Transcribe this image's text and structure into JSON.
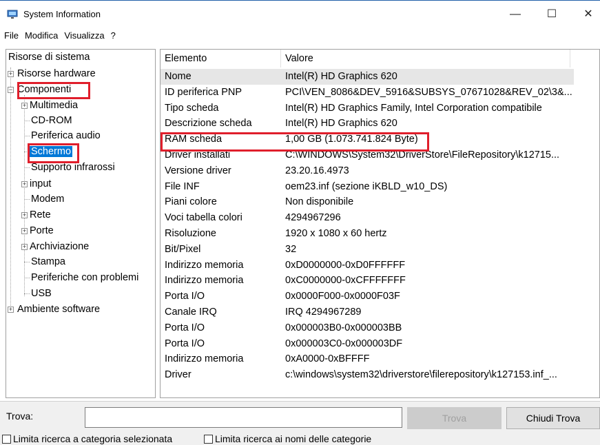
{
  "window": {
    "title": "System Information"
  },
  "window_controls": {
    "minimize": "—",
    "maximize": "☐",
    "close": "✕"
  },
  "menu": [
    "File",
    "Modifica",
    "Visualizza",
    "?"
  ],
  "tree": {
    "root": "Risorse di sistema",
    "items": [
      {
        "label": "Risorse hardware"
      },
      {
        "label": "Componenti"
      },
      {
        "label": "Multimedia"
      },
      {
        "label": "CD-ROM"
      },
      {
        "label": "Periferica audio"
      },
      {
        "label": "Schermo"
      },
      {
        "label": "Supporto infrarossi"
      },
      {
        "label": "input"
      },
      {
        "label": "Modem"
      },
      {
        "label": "Rete"
      },
      {
        "label": "Porte"
      },
      {
        "label": "Archiviazione"
      },
      {
        "label": "Stampa"
      },
      {
        "label": "Periferiche con problemi"
      },
      {
        "label": "USB"
      },
      {
        "label": "Ambiente software"
      }
    ]
  },
  "detail": {
    "columns": [
      "Elemento",
      "Valore"
    ],
    "rows": [
      {
        "name": "Nome",
        "value": "Intel(R) HD Graphics 620"
      },
      {
        "name": "ID periferica PNP",
        "value": "PCI\\VEN_8086&DEV_5916&SUBSYS_07671028&REV_02\\3&..."
      },
      {
        "name": "Tipo scheda",
        "value": "Intel(R) HD Graphics Family, Intel Corporation compatibile"
      },
      {
        "name": "Descrizione scheda",
        "value": "Intel(R) HD Graphics 620"
      },
      {
        "name": "RAM scheda",
        "value": "1,00 GB (1.073.741.824 Byte)"
      },
      {
        "name": "Driver installati",
        "value": "C:\\WINDOWS\\System32\\DriverStore\\FileRepository\\k12715..."
      },
      {
        "name": "Versione driver",
        "value": "23.20.16.4973"
      },
      {
        "name": "File INF",
        "value": "oem23.inf (sezione iKBLD_w10_DS)"
      },
      {
        "name": "Piani colore",
        "value": "Non disponibile"
      },
      {
        "name": "Voci tabella colori",
        "value": "4294967296"
      },
      {
        "name": "Risoluzione",
        "value": "1920 x 1080 x 60 hertz"
      },
      {
        "name": "Bit/Pixel",
        "value": "32"
      },
      {
        "name": "Indirizzo memoria",
        "value": "0xD0000000-0xD0FFFFFF"
      },
      {
        "name": "Indirizzo memoria",
        "value": "0xC0000000-0xCFFFFFFF"
      },
      {
        "name": "Porta I/O",
        "value": "0x0000F000-0x0000F03F"
      },
      {
        "name": "Canale IRQ",
        "value": "IRQ 4294967289"
      },
      {
        "name": "Porta I/O",
        "value": "0x000003B0-0x000003BB"
      },
      {
        "name": "Porta I/O",
        "value": "0x000003C0-0x000003DF"
      },
      {
        "name": "Indirizzo memoria",
        "value": "0xA0000-0xBFFFF"
      },
      {
        "name": "Driver",
        "value": "c:\\windows\\system32\\driverstore\\filerepository\\k127153.inf_..."
      }
    ]
  },
  "find": {
    "label": "Trova:",
    "value": "",
    "find_button": "Trova",
    "close_button": "Chiudi Trova",
    "option_category": "Limita ricerca a categoria selezionata",
    "option_names": "Limita ricerca ai nomi delle categorie"
  },
  "colors": {
    "selection": "#0078d7",
    "annotation": "#e01e2b"
  }
}
